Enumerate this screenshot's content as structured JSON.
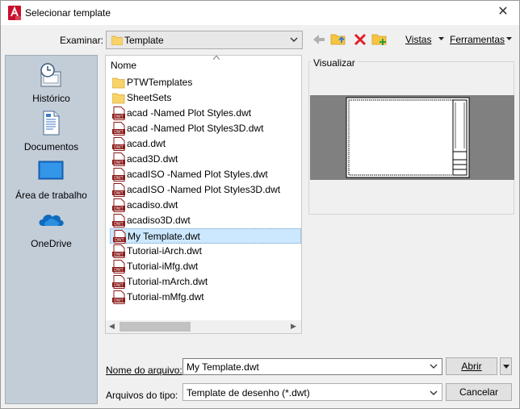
{
  "window": {
    "title": "Selecionar template",
    "close": "✕"
  },
  "toolbar": {
    "lookin_label": "Examinar:",
    "lookin_value": "Template",
    "views_label": "Vistas",
    "tools_label": "Ferramentas"
  },
  "places": [
    {
      "label": "Histórico",
      "icon": "history-icon"
    },
    {
      "label": "Documentos",
      "icon": "documents-icon"
    },
    {
      "label": "Área de trabalho",
      "icon": "desktop-icon"
    },
    {
      "label": "OneDrive",
      "icon": "onedrive-icon"
    }
  ],
  "filelist": {
    "column": "Nome",
    "items": [
      {
        "name": "PTWTemplates",
        "type": "folder"
      },
      {
        "name": "SheetSets",
        "type": "folder"
      },
      {
        "name": "acad -Named Plot Styles.dwt",
        "type": "dwt"
      },
      {
        "name": "acad -Named Plot Styles3D.dwt",
        "type": "dwt"
      },
      {
        "name": "acad.dwt",
        "type": "dwt"
      },
      {
        "name": "acad3D.dwt",
        "type": "dwt"
      },
      {
        "name": "acadISO -Named Plot Styles.dwt",
        "type": "dwt"
      },
      {
        "name": "acadISO -Named Plot Styles3D.dwt",
        "type": "dwt"
      },
      {
        "name": "acadiso.dwt",
        "type": "dwt"
      },
      {
        "name": "acadiso3D.dwt",
        "type": "dwt"
      },
      {
        "name": "My Template.dwt",
        "type": "dwt",
        "selected": true
      },
      {
        "name": "Tutorial-iArch.dwt",
        "type": "dwt"
      },
      {
        "name": "Tutorial-iMfg.dwt",
        "type": "dwt"
      },
      {
        "name": "Tutorial-mArch.dwt",
        "type": "dwt"
      },
      {
        "name": "Tutorial-mMfg.dwt",
        "type": "dwt"
      }
    ]
  },
  "preview": {
    "label": "Visualizar"
  },
  "footer": {
    "filename_label": "Nome do arquivo:",
    "filename_value": "My Template.dwt",
    "filetype_label": "Arquivos do tipo:",
    "filetype_value": "Template de desenho (*.dwt)",
    "open_label": "Abrir",
    "cancel_label": "Cancelar"
  },
  "colors": {
    "sidebar": "#c3cdd8",
    "selection": "#cce8ff",
    "brand_red": "#c8102e",
    "preview_bg": "#808080"
  }
}
